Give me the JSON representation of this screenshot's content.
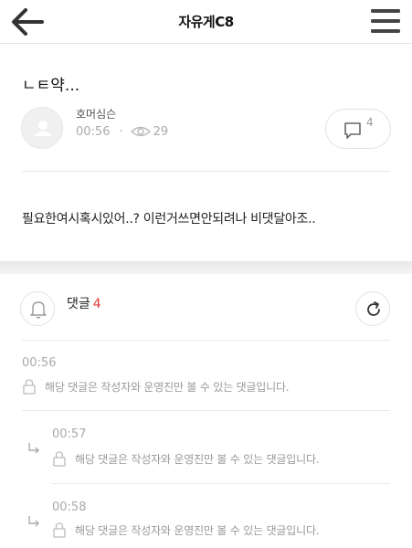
{
  "header": {
    "title": "자유게C8",
    "back_icon": "arrow-left-icon",
    "menu_icon": "hamburger-menu-icon"
  },
  "post": {
    "title": "ㄴㅌ약...",
    "author": "호머심슨",
    "time": "00:56",
    "separator": "·",
    "views": "29",
    "comment_count": "4",
    "body": "필요한여시혹시있어..? 이런거쓰면안되려나 비댓달아조.."
  },
  "comments_section": {
    "label": "댓글",
    "count": "4",
    "accent_color": "#e23a3a",
    "items": [
      {
        "time": "00:56",
        "text": "해당 댓글은 작성자와 운영진만 볼 수 있는 댓글입니다.",
        "reply": false
      },
      {
        "time": "00:57",
        "text": "해당 댓글은 작성자와 운영진만 볼 수 있는 댓글입니다.",
        "reply": true
      },
      {
        "time": "00:58",
        "text": "해당 댓글은 작성자와 운영진만 볼 수 있는 댓글입니다.",
        "reply": true
      }
    ]
  }
}
